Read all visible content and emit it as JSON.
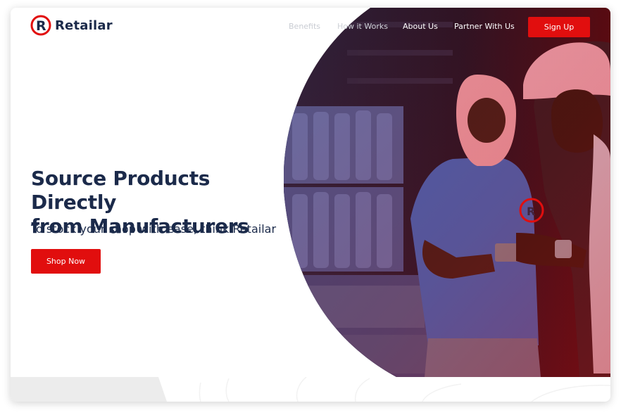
{
  "brand": {
    "name": "Retailar",
    "logo_letter": "R",
    "color_primary": "#e10e0e",
    "color_text": "#1b2a4a"
  },
  "nav": {
    "benefits": "Benefits",
    "how_it_works": "How it Works",
    "about_us": "About Us",
    "partner_with_us": "Partner With Us",
    "signup": "Sign Up"
  },
  "hero": {
    "headline_line1": "Source Products Directly",
    "headline_line2": "from Manufacturers",
    "subheadline": "To stock your shop with ease, think Retailar",
    "cta": "Shop Now",
    "shirt_logo_letter": "R"
  }
}
